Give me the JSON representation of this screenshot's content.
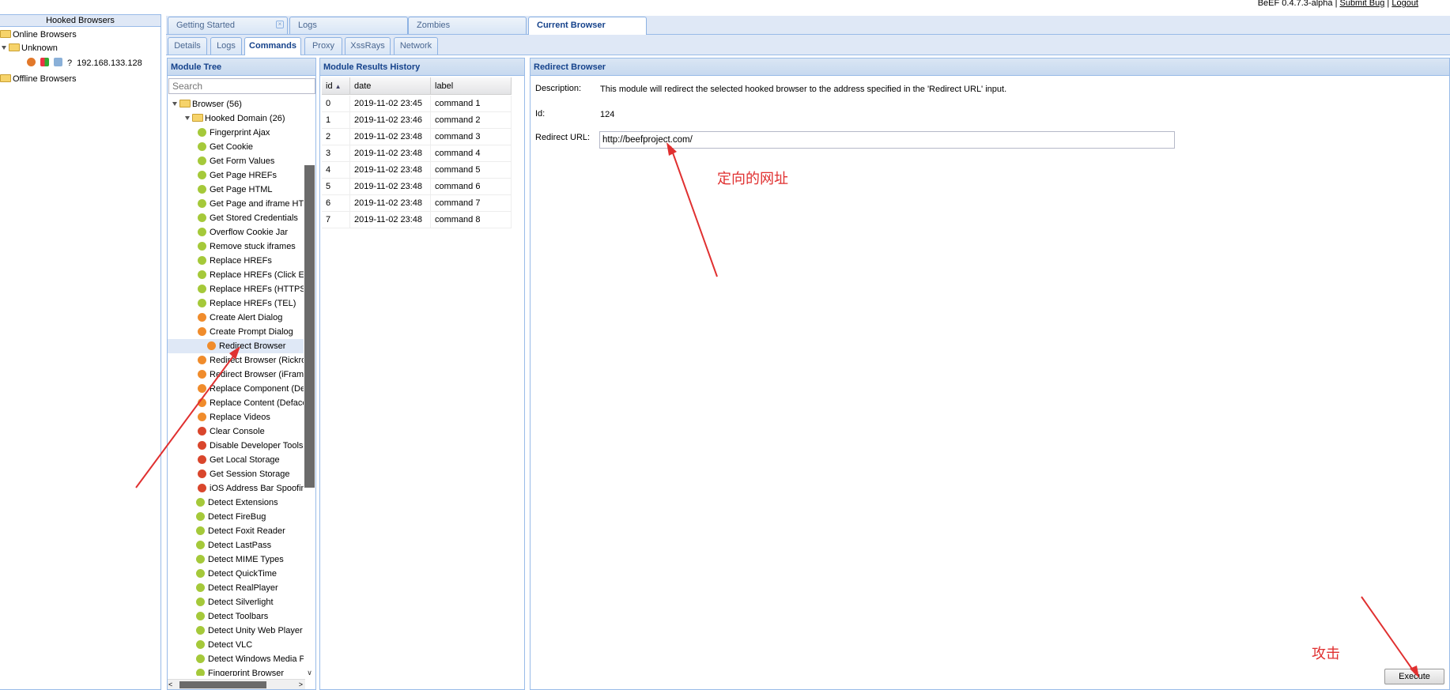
{
  "header": {
    "app_version": "BeEF  0.4.7.3-alpha",
    "separator": "|",
    "submit_bug": "Submit  Bug",
    "logout": "Logout"
  },
  "west": {
    "title": "Hooked Browsers",
    "online": "Online Browsers",
    "unknown": "Unknown",
    "host_ip": "192.168.133.128",
    "host_unknown_glyph": "?",
    "offline": "Offline Browsers"
  },
  "tabs": [
    "Getting Started",
    "Logs",
    "Zombies",
    "Current Browser"
  ],
  "tab_close_glyph": "×",
  "subtabs": [
    "Details",
    "Logs",
    "Commands",
    "Proxy",
    "XssRays",
    "Network"
  ],
  "module_tree": {
    "title": "Module Tree",
    "search_placeholder": "Search",
    "browser_folder": "Browser (56)",
    "hooked_domain_folder": "Hooked Domain (26)",
    "selected_index": 15,
    "hooked_domain_items": [
      {
        "label": "Fingerprint Ajax",
        "status": "green"
      },
      {
        "label": "Get Cookie",
        "status": "green"
      },
      {
        "label": "Get Form Values",
        "status": "green"
      },
      {
        "label": "Get Page HREFs",
        "status": "green"
      },
      {
        "label": "Get Page HTML",
        "status": "green"
      },
      {
        "label": "Get Page and iframe HTML",
        "status": "green"
      },
      {
        "label": "Get Stored Credentials",
        "status": "green"
      },
      {
        "label": "Overflow Cookie Jar",
        "status": "green"
      },
      {
        "label": "Remove stuck iframes",
        "status": "green"
      },
      {
        "label": "Replace HREFs",
        "status": "green"
      },
      {
        "label": "Replace HREFs (Click Events)",
        "status": "green"
      },
      {
        "label": "Replace HREFs (HTTPS)",
        "status": "green"
      },
      {
        "label": "Replace HREFs (TEL)",
        "status": "green"
      },
      {
        "label": "Create Alert Dialog",
        "status": "orange"
      },
      {
        "label": "Create Prompt Dialog",
        "status": "orange"
      },
      {
        "label": "Redirect Browser",
        "status": "orange"
      },
      {
        "label": "Redirect Browser (Rickroll)",
        "status": "orange"
      },
      {
        "label": "Redirect Browser (iFrame)",
        "status": "orange"
      },
      {
        "label": "Replace Component (Deface)",
        "status": "orange"
      },
      {
        "label": "Replace Content (Deface)",
        "status": "orange"
      },
      {
        "label": "Replace Videos",
        "status": "orange"
      },
      {
        "label": "Clear Console",
        "status": "red"
      },
      {
        "label": "Disable Developer Tools",
        "status": "red"
      },
      {
        "label": "Get Local Storage",
        "status": "red"
      },
      {
        "label": "Get Session Storage",
        "status": "red"
      },
      {
        "label": "iOS Address Bar Spoofing",
        "status": "red"
      }
    ],
    "browser_items": [
      {
        "label": "Detect Extensions",
        "status": "green"
      },
      {
        "label": "Detect FireBug",
        "status": "green"
      },
      {
        "label": "Detect Foxit Reader",
        "status": "green"
      },
      {
        "label": "Detect LastPass",
        "status": "green"
      },
      {
        "label": "Detect MIME Types",
        "status": "green"
      },
      {
        "label": "Detect QuickTime",
        "status": "green"
      },
      {
        "label": "Detect RealPlayer",
        "status": "green"
      },
      {
        "label": "Detect Silverlight",
        "status": "green"
      },
      {
        "label": "Detect Toolbars",
        "status": "green"
      },
      {
        "label": "Detect Unity Web Player",
        "status": "green"
      },
      {
        "label": "Detect VLC",
        "status": "green"
      },
      {
        "label": "Detect Windows Media Player",
        "status": "green"
      },
      {
        "label": "Fingerprint Browser",
        "status": "green"
      }
    ]
  },
  "status_colors": {
    "green": "#a5c93a",
    "orange": "#f08c2c",
    "red": "#d9462c"
  },
  "results": {
    "title": "Module Results History",
    "columns": [
      "id",
      "date",
      "label"
    ],
    "rows": [
      [
        "0",
        "2019-11-02 23:45",
        "command 1"
      ],
      [
        "1",
        "2019-11-02 23:46",
        "command 2"
      ],
      [
        "2",
        "2019-11-02 23:48",
        "command 3"
      ],
      [
        "3",
        "2019-11-02 23:48",
        "command 4"
      ],
      [
        "4",
        "2019-11-02 23:48",
        "command 5"
      ],
      [
        "5",
        "2019-11-02 23:48",
        "command 6"
      ],
      [
        "6",
        "2019-11-02 23:48",
        "command 7"
      ],
      [
        "7",
        "2019-11-02 23:48",
        "command 8"
      ]
    ]
  },
  "detail": {
    "title": "Redirect Browser",
    "description_label": "Description:",
    "description": "This module will redirect the selected hooked browser to the address specified in the 'Redirect URL' input.",
    "id_label": "Id:",
    "id_value": "124",
    "url_label": "Redirect URL:",
    "url_value": "http://beefproject.com/",
    "execute_label": "Execute"
  },
  "annotations": {
    "url_note": "定向的网址",
    "attack_note": "攻击"
  },
  "annotation_color": "#e03030"
}
